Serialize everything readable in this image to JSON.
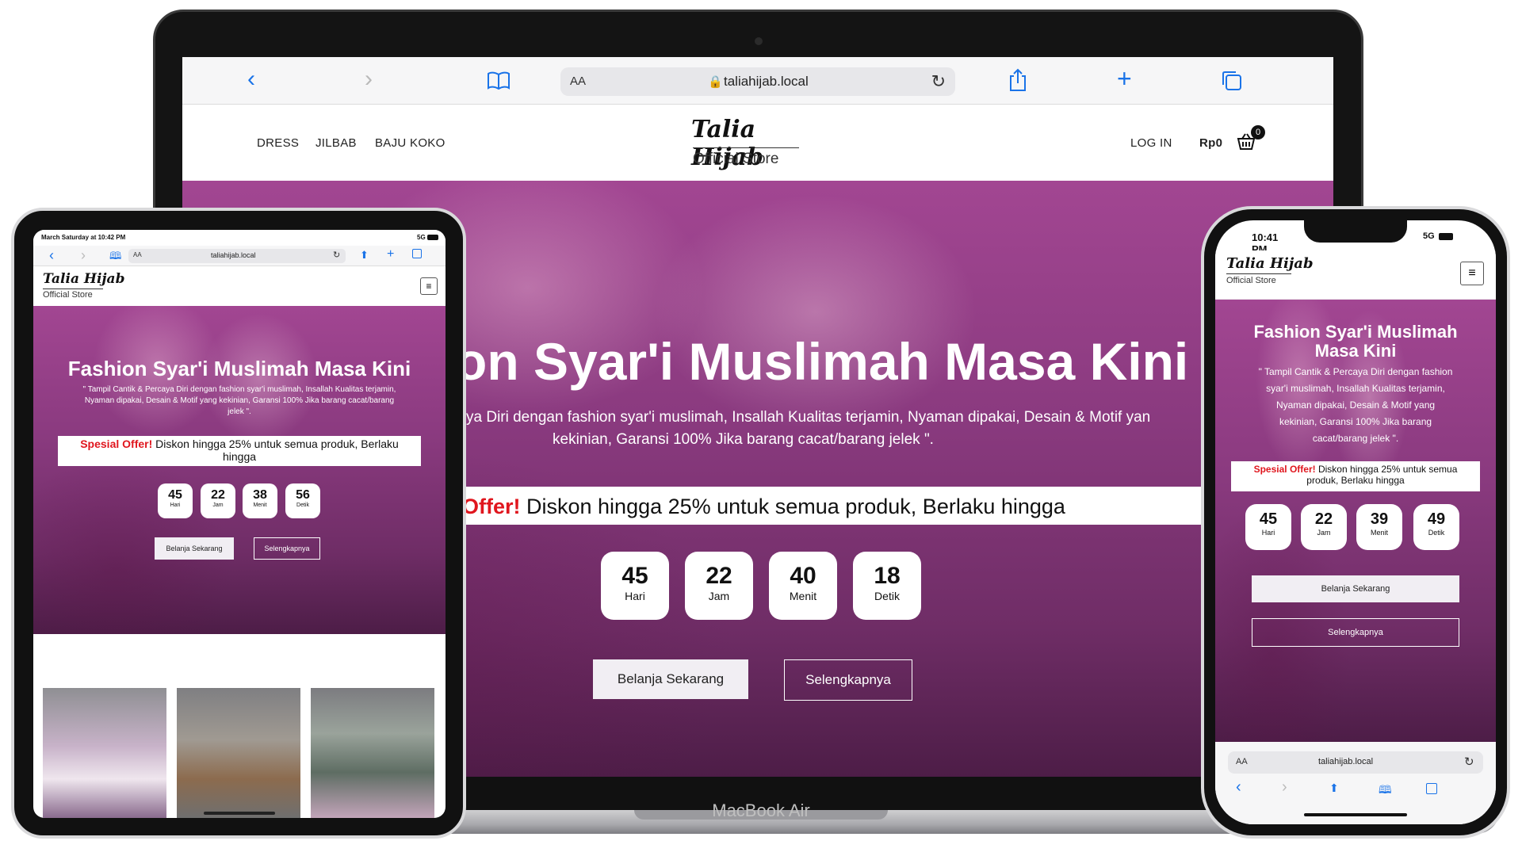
{
  "laptop": {
    "brand": "MacBook Air",
    "browser": {
      "reader_label": "AA",
      "url": "taliahijab.local"
    },
    "nav": {
      "links": [
        "DRESS",
        "JILBAB",
        "BAJU KOKO"
      ],
      "login": "LOG IN",
      "cart_total": "Rp0",
      "cart_count": "0"
    },
    "logo": {
      "name": "Talia Hijab",
      "tagline": "Official Store"
    },
    "hero": {
      "title": "on Syar'i Muslimah Masa Kini",
      "subtitle_line1": "ya Diri dengan fashion syar'i muslimah, Insallah Kualitas terjamin, Nyaman dipakai, Desain & Motif yan",
      "subtitle_line2": "kekinian, Garansi 100% Jika barang cacat/barang jelek \".",
      "offer_label": "Offer!",
      "offer_text": " Diskon hingga 25% untuk semua produk, Berlaku hingga",
      "countdown": [
        {
          "value": "45",
          "label": "Hari"
        },
        {
          "value": "22",
          "label": "Jam"
        },
        {
          "value": "40",
          "label": "Menit"
        },
        {
          "value": "18",
          "label": "Detik"
        }
      ],
      "btn_shop": "Belanja Sekarang",
      "btn_more": "Selengkapnya"
    }
  },
  "tablet": {
    "status_time": "March Saturday at 10:42 PM",
    "status_net": "5G",
    "browser": {
      "reader_label": "AA",
      "url": "taliahijab.local"
    },
    "logo": {
      "name": "Talia Hijab",
      "tagline": "Official Store"
    },
    "hero": {
      "title": "Fashion Syar'i Muslimah Masa Kini",
      "subtitle_line1": "\" Tampil Cantik & Percaya Diri dengan fashion syar'i muslimah, Insallah Kualitas terjamin,",
      "subtitle_line2": "Nyaman dipakai, Desain & Motif yang kekinian, Garansi 100% Jika barang cacat/barang",
      "subtitle_line3": "jelek \".",
      "offer_label": "Spesial Offer!",
      "offer_text": " Diskon hingga 25% untuk semua produk, Berlaku",
      "offer_text2": "hingga",
      "countdown": [
        {
          "value": "45",
          "label": "Hari"
        },
        {
          "value": "22",
          "label": "Jam"
        },
        {
          "value": "38",
          "label": "Menit"
        },
        {
          "value": "56",
          "label": "Detik"
        }
      ],
      "btn_shop": "Belanja Sekarang",
      "btn_more": "Selengkapnya"
    }
  },
  "phone": {
    "status_time": "10:41 PM",
    "status_net": "5G",
    "browser": {
      "reader_label": "AA",
      "url": "taliahijab.local"
    },
    "logo": {
      "name": "Talia Hijab",
      "tagline": "Official Store"
    },
    "hero": {
      "title_line1": "Fashion Syar'i Muslimah",
      "title_line2": "Masa Kini",
      "subtitle_lines": [
        "\" Tampil Cantik & Percaya Diri dengan fashion",
        "syar'i muslimah, Insallah Kualitas terjamin,",
        "Nyaman dipakai, Desain & Motif yang",
        "kekinian, Garansi 100% Jika barang",
        "cacat/barang jelek \"."
      ],
      "offer_label": "Spesial Offer!",
      "offer_text": " Diskon hingga 25% untuk semua",
      "offer_text2": "produk, Berlaku hingga",
      "countdown": [
        {
          "value": "45",
          "label": "Hari"
        },
        {
          "value": "22",
          "label": "Jam"
        },
        {
          "value": "39",
          "label": "Menit"
        },
        {
          "value": "49",
          "label": "Detik"
        }
      ],
      "btn_shop": "Belanja Sekarang",
      "btn_more": "Selengkapnya"
    }
  },
  "colors": {
    "accent_blue": "#1a73e8",
    "hero_purple": "#8a3a7f",
    "offer_red": "#e0161e"
  }
}
